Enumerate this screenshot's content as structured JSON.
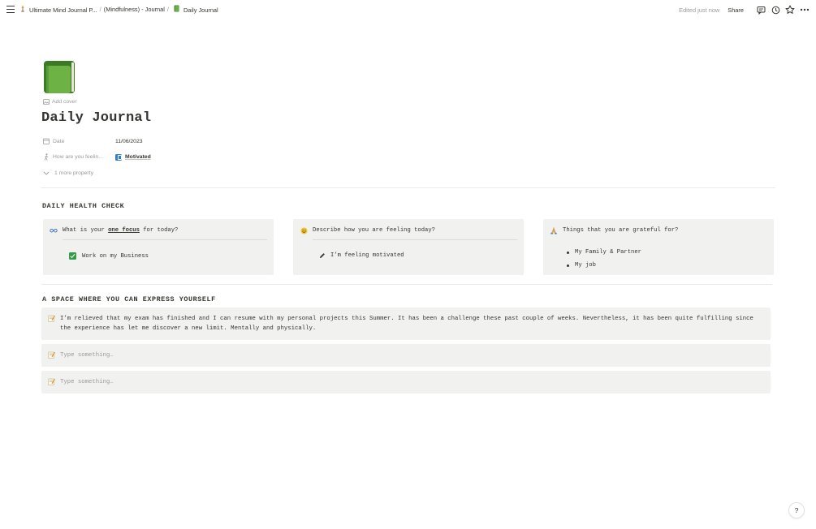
{
  "breadcrumb": {
    "items": [
      {
        "label": "Ultimate Mind Journal P...",
        "icon": "lamp-icon"
      },
      {
        "label": "(Mindfulness) - Journal"
      },
      {
        "label": "Daily Journal",
        "icon": "green-book-icon"
      }
    ],
    "separator": "/"
  },
  "topbar": {
    "edited": "Edited just now",
    "share_label": "Share",
    "icons": [
      "comment-icon",
      "history-icon",
      "star-icon",
      "more-icon"
    ]
  },
  "page": {
    "icon": "green-book-icon",
    "add_cover": "Add cover",
    "title": "Daily Journal"
  },
  "properties": {
    "date": {
      "label": "Date",
      "value": "11/06/2023"
    },
    "feeling": {
      "label": "How are you feelin...",
      "value": "Motivated"
    },
    "more": "1 more property"
  },
  "health_check": {
    "heading": "DAILY HEALTH CHECK",
    "focus": {
      "prefix": "What is your ",
      "bold": "one focus",
      "suffix": " for today?",
      "todo": "Work on my Business",
      "checked": true
    },
    "feeling": {
      "question": "Describe how you are feeling today?",
      "answer": "I’m feeling motivated"
    },
    "grateful": {
      "question": "Things that you are grateful for?",
      "items": [
        "My Family & Partner",
        "My job"
      ]
    }
  },
  "express": {
    "heading": "A SPACE WHERE YOU CAN EXPRESS YOURSELF",
    "entry": "I’m relieved that my exam has finished and I can resume with my personal projects this Summer. It has been a challenge these past couple of weeks. Nevertheless, it has been quite fulfilling since the experience has let me discover a new limit. Mentally and physically.",
    "placeholder_1": "Type something…",
    "placeholder_2": "Type something…"
  },
  "help_label": "?",
  "colors": {
    "text": "#37352f",
    "muted": "#9b9a97",
    "callout_bg": "#f1f1ef",
    "checkbox": "#2f9e44",
    "book_green": "#5e9c3f"
  }
}
